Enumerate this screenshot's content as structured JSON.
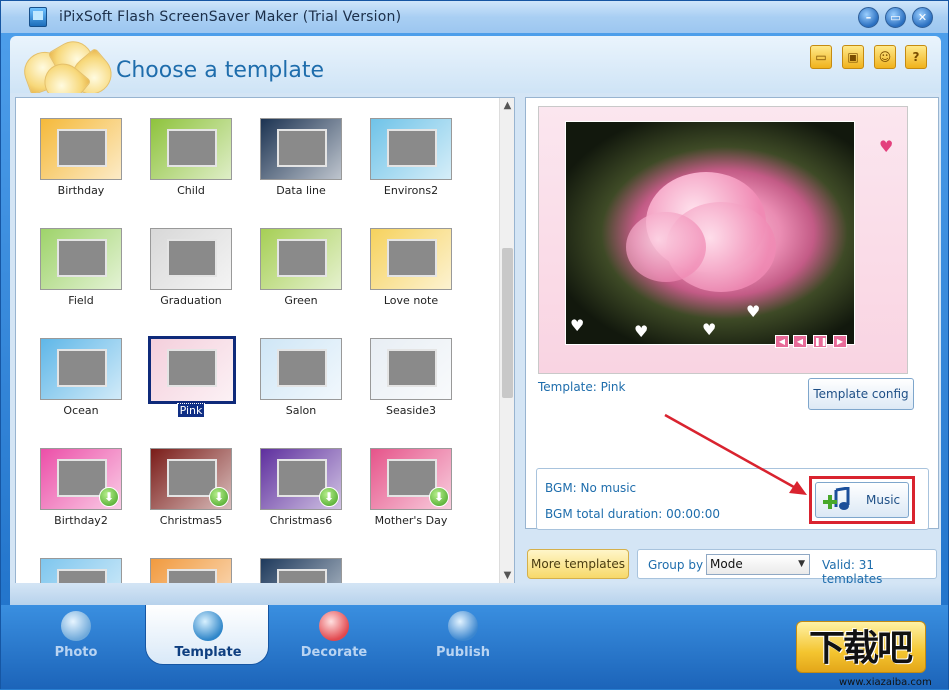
{
  "window": {
    "title": "iPixSoft Flash ScreenSaver Maker (Trial Version)"
  },
  "header": {
    "title": "Choose a template"
  },
  "templates": [
    {
      "label": "Birthday",
      "bg": "#f5b93a",
      "download": false
    },
    {
      "label": "Child",
      "bg": "#8ec33c",
      "download": false
    },
    {
      "label": "Data line",
      "bg": "#1c3352",
      "download": false
    },
    {
      "label": "Environs2",
      "bg": "#6fc3e8",
      "download": false
    },
    {
      "label": "Field",
      "bg": "#9ed36a",
      "download": false
    },
    {
      "label": "Graduation",
      "bg": "#d8d8d8",
      "download": false
    },
    {
      "label": "Green",
      "bg": "#a6cf55",
      "download": false
    },
    {
      "label": "Love note",
      "bg": "#f6d25d",
      "download": false
    },
    {
      "label": "Ocean",
      "bg": "#5fb7e8",
      "download": false
    },
    {
      "label": "Pink",
      "bg": "#f4cfdc",
      "download": false
    },
    {
      "label": "Salon",
      "bg": "#cfe6f6",
      "download": false
    },
    {
      "label": "Seaside3",
      "bg": "#e8eef4",
      "download": false
    },
    {
      "label": "Birthday2",
      "bg": "#ec4fa8",
      "download": true
    },
    {
      "label": "Christmas5",
      "bg": "#7a1c18",
      "download": true
    },
    {
      "label": "Christmas6",
      "bg": "#5e2f9e",
      "download": true
    },
    {
      "label": "Mother's Day",
      "bg": "#e6548a",
      "download": true
    },
    {
      "label": "",
      "bg": "#7ec6ee",
      "download": false
    },
    {
      "label": "",
      "bg": "#f19a3e",
      "download": false
    },
    {
      "label": "",
      "bg": "#1e3a5c",
      "download": false
    }
  ],
  "preview": {
    "template_line": "Template: Pink",
    "config_button": "Template config"
  },
  "bgm": {
    "music_line": "BGM: No music",
    "duration_line": "BGM total duration: 00:00:00",
    "music_button": "Music"
  },
  "bottom_bar": {
    "more_templates": "More templates",
    "group_by_label": "Group by",
    "group_by_value": "Mode",
    "valid_text": "Valid: 31 templates"
  },
  "nav": {
    "items": [
      {
        "label": "Photo"
      },
      {
        "label": "Template"
      },
      {
        "label": "Decorate"
      },
      {
        "label": "Publish"
      }
    ]
  },
  "watermark": {
    "main": "下载吧",
    "sub": "www.xiazaiba.com"
  },
  "colors": {
    "accent": "#1e6dac",
    "highlight_red": "#d9232f",
    "selected_navy": "#102f85"
  }
}
